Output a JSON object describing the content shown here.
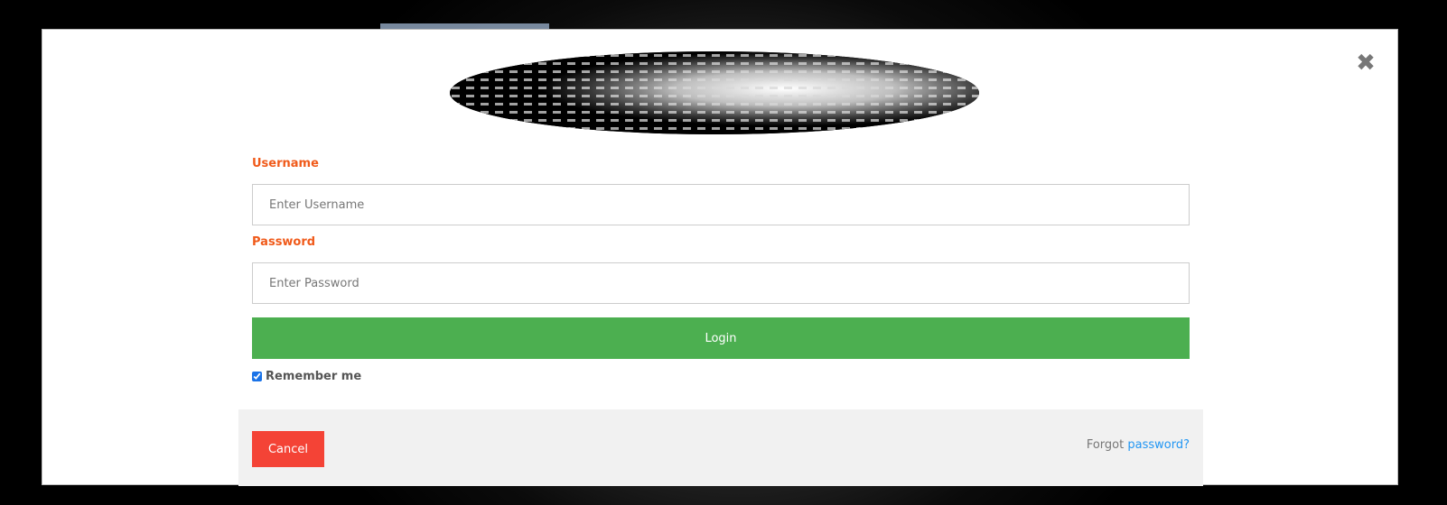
{
  "modal": {
    "close_glyph": "✖",
    "avatar": {
      "icon": "avatar-image"
    }
  },
  "form": {
    "username_label": "Username",
    "username_placeholder": "Enter Username",
    "password_label": "Password",
    "password_placeholder": "Enter Password",
    "login_label": "Login",
    "remember_label": "Remember me",
    "remember_checked": true
  },
  "footer": {
    "cancel_label": "Cancel",
    "forgot_prefix": "Forgot",
    "forgot_link": "password?"
  },
  "colors": {
    "label_orange": "#f05a1a",
    "login_green": "#4caf50",
    "cancel_red": "#f44336",
    "link_blue": "#2196f3"
  }
}
